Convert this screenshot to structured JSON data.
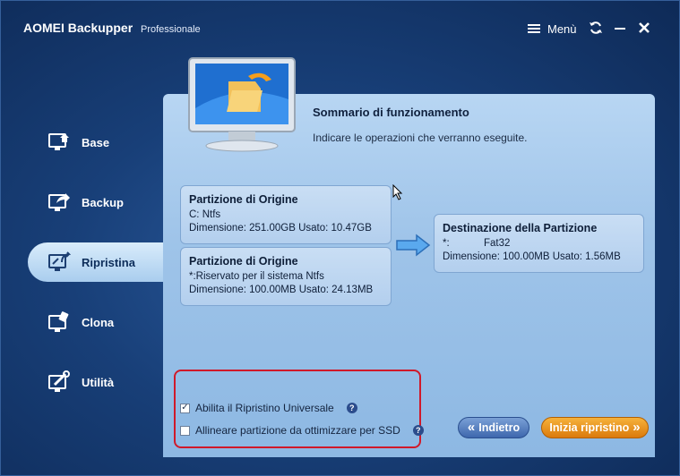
{
  "app": {
    "title": "AOMEI Backupper",
    "edition": "Professionale",
    "menu_label": "Menù"
  },
  "sidebar": {
    "items": [
      {
        "label": "Base",
        "icon": "monitor-home-icon",
        "active": false
      },
      {
        "label": "Backup",
        "icon": "monitor-export-icon",
        "active": false
      },
      {
        "label": "Ripristina",
        "icon": "monitor-restore-icon",
        "active": true
      },
      {
        "label": "Clona",
        "icon": "monitor-clone-icon",
        "active": false
      },
      {
        "label": "Utilità",
        "icon": "monitor-tools-icon",
        "active": false
      }
    ]
  },
  "main": {
    "title": "Sommario di funzionamento",
    "subtitle": "Indicare le operazioni che verranno eseguite.",
    "sources": [
      {
        "title": "Partizione di Origine",
        "line1": "C: Ntfs",
        "line2": "Dimensione: 251.00GB  Usato: 10.47GB"
      },
      {
        "title": "Partizione di Origine",
        "line1": "*:Riservato per il sistema Ntfs",
        "line2": "Dimensione: 100.00MB  Usato: 24.13MB"
      }
    ],
    "destination": {
      "title": "Destinazione della Partizione",
      "line1": "*:            Fat32",
      "line2": "Dimensione: 100.00MB  Usato: 1.56MB"
    }
  },
  "options": {
    "universal_restore_label": "Abilita il Ripristino Universale",
    "universal_restore_checked": true,
    "ssd_align_label": "Allineare partizione da ottimizzare per SSD",
    "ssd_align_checked": false,
    "help_glyph": "?"
  },
  "buttons": {
    "back_label": "Indietro",
    "back_chevron": "«",
    "start_label": "Inizia ripristino",
    "start_chevron": "»"
  },
  "colors": {
    "accent_orange": "#db7a0c",
    "highlight_red": "#d0192a",
    "panel_blue": "#9fc4e9"
  }
}
